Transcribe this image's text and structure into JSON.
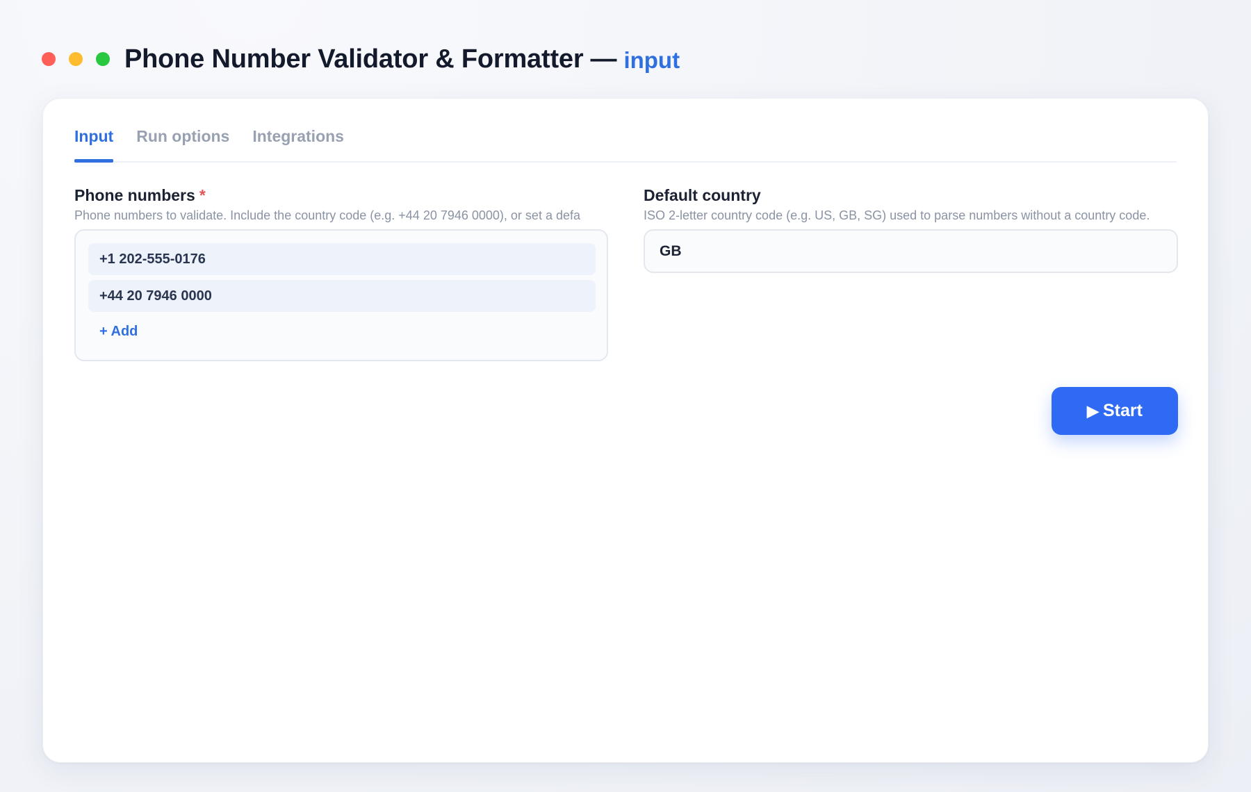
{
  "window": {
    "title": "Phone Number Validator & Formatter",
    "separator": "—",
    "mode": "input"
  },
  "tabs": [
    {
      "label": "Input",
      "active": true
    },
    {
      "label": "Run options",
      "active": false
    },
    {
      "label": "Integrations",
      "active": false
    }
  ],
  "phone_numbers": {
    "label": "Phone numbers",
    "required_mark": "*",
    "help": "Phone numbers to validate. Include the country code (e.g. +44 20 7946 0000), or set a defa",
    "items": [
      "+1 202-555-0176",
      "+44 20 7946 0000"
    ],
    "add_label": "+ Add"
  },
  "default_country": {
    "label": "Default country",
    "help": "ISO 2-letter country code (e.g. US, GB, SG) used to parse numbers without a country code.",
    "value": "GB"
  },
  "actions": {
    "start_icon": "play-icon",
    "start_glyph": "▶",
    "start_label": "Start"
  },
  "colors": {
    "accent": "#2f6fe0",
    "button": "#2f6af5",
    "required": "#e25555"
  }
}
